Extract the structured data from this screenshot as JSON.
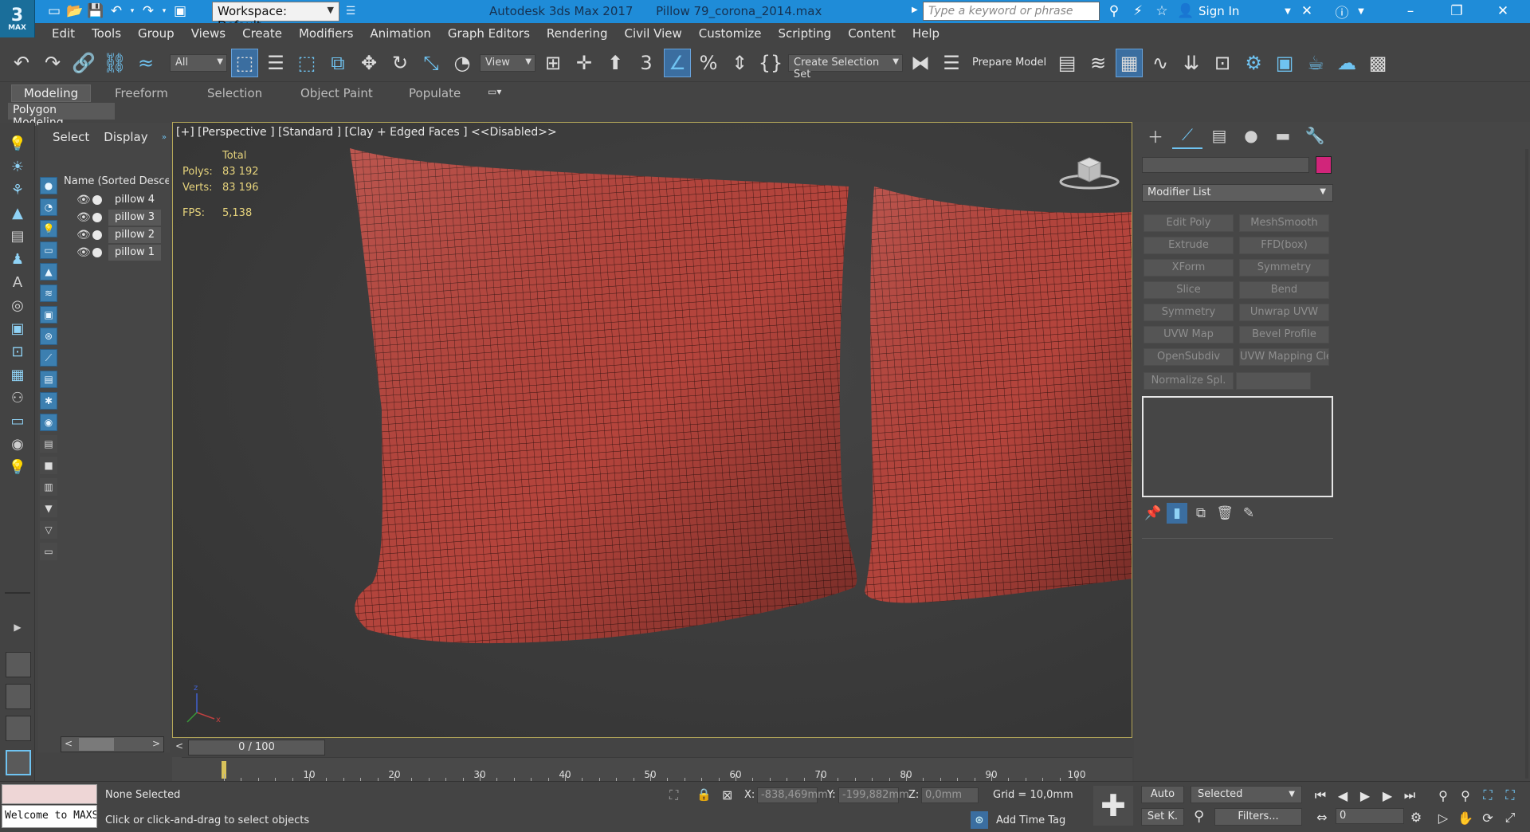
{
  "colors": {
    "titlebar": "#1f8cd8",
    "accent": "#6fc3f1",
    "object_color": "#d1257a",
    "pillow": "#b4443c"
  },
  "titlebar": {
    "logo": "3",
    "logo_sub": "MAX",
    "workspace": "Workspace: Default",
    "app_name": "Autodesk 3ds Max 2017",
    "file_name": "Pillow 79_corona_2014.max",
    "search_placeholder": "Type a keyword or phrase",
    "sign_in": "Sign In"
  },
  "menu": [
    "Edit",
    "Tools",
    "Group",
    "Views",
    "Create",
    "Modifiers",
    "Animation",
    "Graph Editors",
    "Rendering",
    "Civil View",
    "Customize",
    "Scripting",
    "Content",
    "Help"
  ],
  "toolbar": {
    "filter_select": "All",
    "view_select": "View",
    "selection_set": "Create Selection Set",
    "prepare_model": "Prepare Model"
  },
  "ribbon": {
    "tabs": [
      "Modeling",
      "Freeform",
      "Selection",
      "Object Paint",
      "Populate"
    ],
    "active_tab": "Modeling",
    "sub_label": "Polygon Modeling"
  },
  "explorer": {
    "tabs": [
      "Select",
      "Display"
    ],
    "column_header": "Name (Sorted Descending)",
    "items": [
      {
        "name": "pillow 4",
        "selected": false
      },
      {
        "name": "pillow 3",
        "selected": true
      },
      {
        "name": "pillow 2",
        "selected": true
      },
      {
        "name": "pillow 1",
        "selected": true
      }
    ]
  },
  "viewport": {
    "label": "[+] [Perspective ] [Standard ] [Clay + Edged Faces ]  <<Disabled>>",
    "stats_header": "Total",
    "polys_label": "Polys:",
    "polys": "83 192",
    "verts_label": "Verts:",
    "verts": "83 196",
    "fps_label": "FPS:",
    "fps": "5,138"
  },
  "timeline": {
    "position": "0 / 100",
    "ticks": [
      "10",
      "20",
      "30",
      "40",
      "50",
      "60",
      "70",
      "80",
      "90",
      "100"
    ]
  },
  "command_panel": {
    "modifier_list": "Modifier List",
    "modifiers": [
      "Edit Poly",
      "MeshSmooth",
      "Extrude",
      "FFD(box)",
      "XForm",
      "Symmetry",
      "Slice",
      "Bend",
      "Symmetry",
      "Unwrap UVW",
      "UVW Map",
      "Bevel Profile",
      "OpenSubdiv",
      "UVW Mapping Clear",
      "Normalize Spl."
    ]
  },
  "status": {
    "maxscript": "Welcome to MAXScript.",
    "selection": "None Selected",
    "prompt": "Click or click-and-drag to select objects",
    "x_label": "X:",
    "x": "-838,469mm",
    "y_label": "Y:",
    "y": "-199,882mm",
    "z_label": "Z:",
    "z": "0,0mm",
    "grid": "Grid = 10,0mm",
    "add_time_tag": "Add Time Tag",
    "auto": "Auto",
    "set_key": "Set K.",
    "key_filter": "Selected",
    "filters": "Filters...",
    "frame": "0"
  }
}
